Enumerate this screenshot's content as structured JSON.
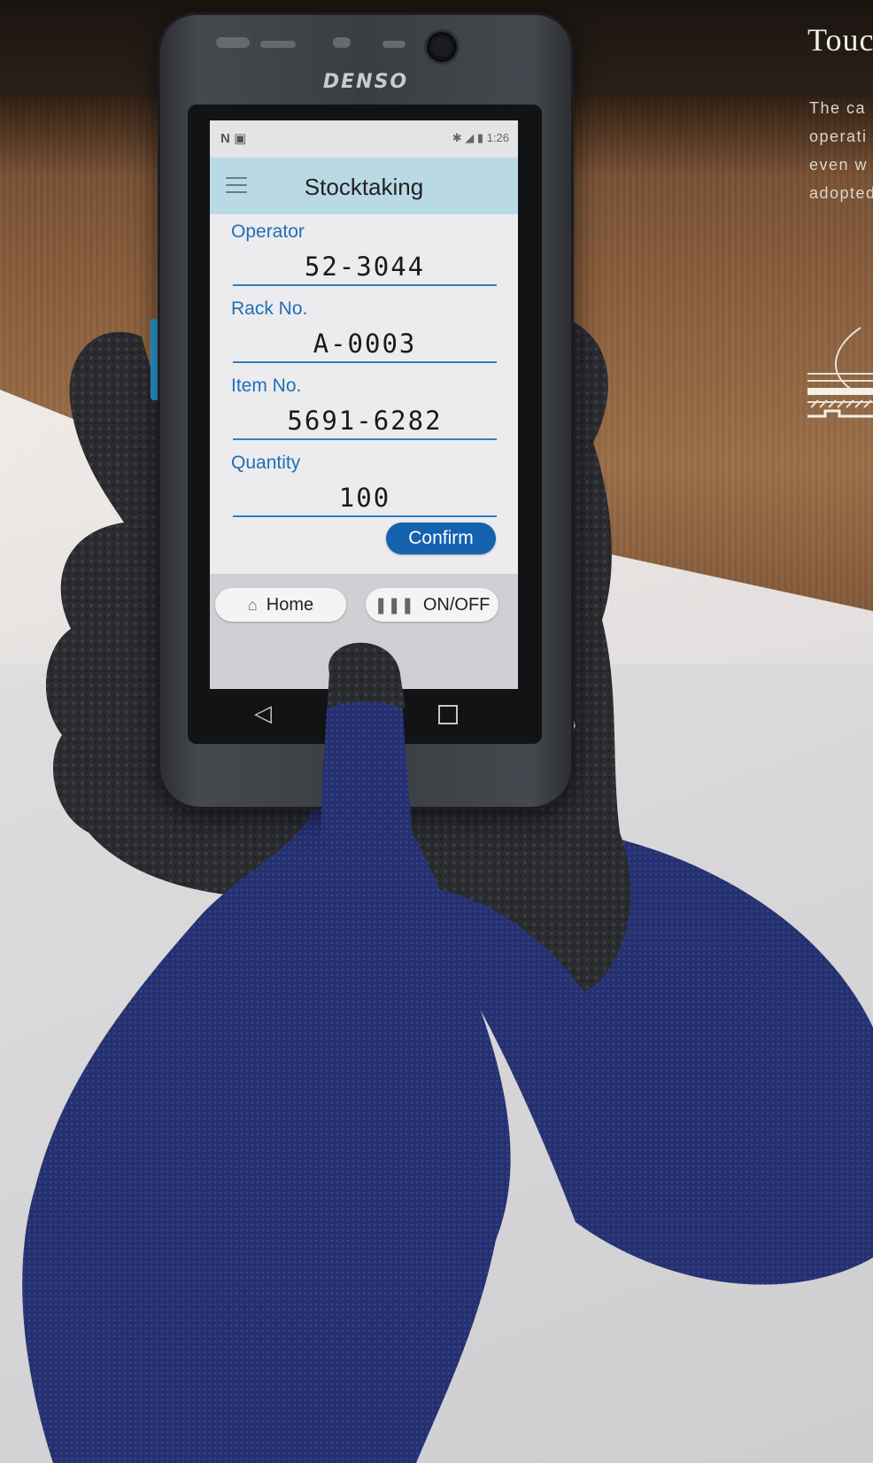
{
  "side_panel": {
    "title": "Touc",
    "paragraph_lines": [
      "The ca",
      "operati",
      "even w",
      "adopted"
    ]
  },
  "device": {
    "brand": "DENSO",
    "side_key_color": "#2a9fd8"
  },
  "status_bar": {
    "left_icons": "N ▣",
    "right_icons": "✱ ◢ ▮",
    "time": "1:26"
  },
  "app": {
    "title": "Stocktaking",
    "menu_icon": "hamburger-menu-icon",
    "header_color": "#b9d9e5",
    "accent_color": "#1462b0",
    "fields": [
      {
        "label": "Operator",
        "value": "52-3044"
      },
      {
        "label": "Rack No.",
        "value": "A-0003"
      },
      {
        "label": "Item No.",
        "value": "5691-6282"
      },
      {
        "label": "Quantity",
        "value": "100"
      }
    ],
    "confirm_label": "Confirm",
    "bottom_buttons": {
      "home_label": "Home",
      "home_icon": "home-icon",
      "onoff_label": "ON/OFF",
      "onoff_icon": "barcode-icon"
    }
  },
  "nav_bar": {
    "back_icon": "back-triangle-icon",
    "recents_icon": "recents-square-icon"
  }
}
